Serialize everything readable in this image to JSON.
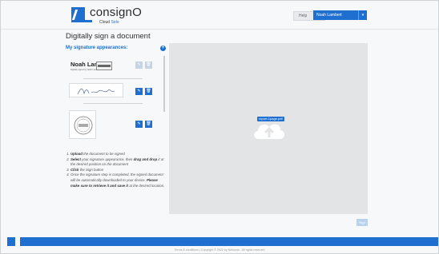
{
  "header": {
    "logo_text": "consignO",
    "logo_sub_prefix": "Cloud",
    "logo_sub_suffix": "Solo",
    "help_label": "Help",
    "help_badge": "?",
    "user_name": "Noah Lambert",
    "user_caret": "▾"
  },
  "page": {
    "title": "Digitally sign a document"
  },
  "signatures": {
    "heading": "My signature appearances:",
    "add_icon": "+",
    "items": [
      {
        "name": "Noah Lambert",
        "sub": "Digitally signed by Noah Lambert",
        "edit": "✎",
        "delete": "🗑"
      },
      {
        "script": "Noah Lambert",
        "edit": "✎",
        "delete": "🗑"
      },
      {
        "edit": "✎",
        "delete": "🗑"
      }
    ]
  },
  "instructions": {
    "steps": [
      {
        "bold": "Upload",
        "text": " the document to be signed"
      },
      {
        "bold": "Select",
        "text": " your signature appearance, then ",
        "bold2": "drag and drop",
        "text2": " it at the desired position on the document"
      },
      {
        "bold": "Click",
        "text": " the Sign button"
      },
      {
        "text": "Once the signature step is completed, the signed document will be automatically downloaded to your device. ",
        "bold": "Please make sure to retrieve it and save it",
        "text2": " at the desired location."
      }
    ]
  },
  "dropzone": {
    "file_name": "report-1page.pdf",
    "cloud_icon": "upload-cloud-icon"
  },
  "actions": {
    "sign_label": "Sign"
  },
  "footer": {
    "text": "Terms & conditions | Copyright © 2022 by Nelsonia - All rights reserved"
  },
  "colors": {
    "accent": "#1f6fd0",
    "dropzone": "#e3e4e6"
  }
}
